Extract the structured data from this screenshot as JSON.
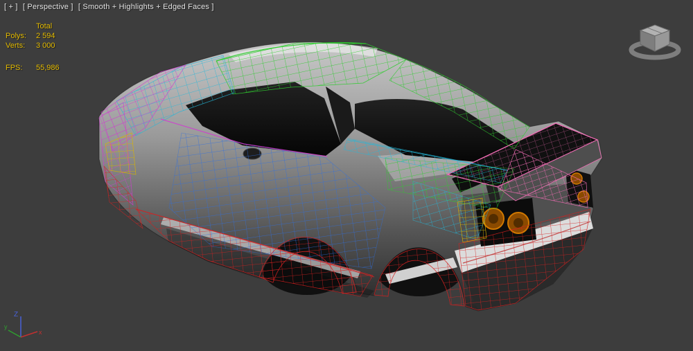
{
  "viewport": {
    "menus": [
      {
        "label": "[ + ]"
      },
      {
        "label": "[ Perspective ]"
      },
      {
        "label": "[ Smooth + Highlights + Edged Faces ]"
      }
    ]
  },
  "statistics": {
    "header": "Total",
    "rows": [
      {
        "label": "Polys:",
        "value": "2 594"
      },
      {
        "label": "Verts:",
        "value": "3 000"
      }
    ],
    "fps": {
      "label": "FPS:",
      "value": "55,986"
    }
  },
  "axis_tripod": {
    "x": "x",
    "y": "y",
    "z": "Z"
  },
  "icons": {
    "view_gizmo": "view-cube-gizmo",
    "axis_tripod": "world-axis-tripod"
  },
  "colors": {
    "viewport_background": "#3d3d3d",
    "viewport_label_text": "#e2e2e2",
    "stats_text": "#e3ba00",
    "mesh_green": "#2ecc2e",
    "mesh_cyan": "#23b6d8",
    "mesh_blue": "#2f6fe0",
    "mesh_red": "#d42020",
    "mesh_magenta": "#d03cd0",
    "mesh_yellow": "#d8b400",
    "mesh_pink": "#f06cb4",
    "taillight_orange": "#c47200"
  }
}
